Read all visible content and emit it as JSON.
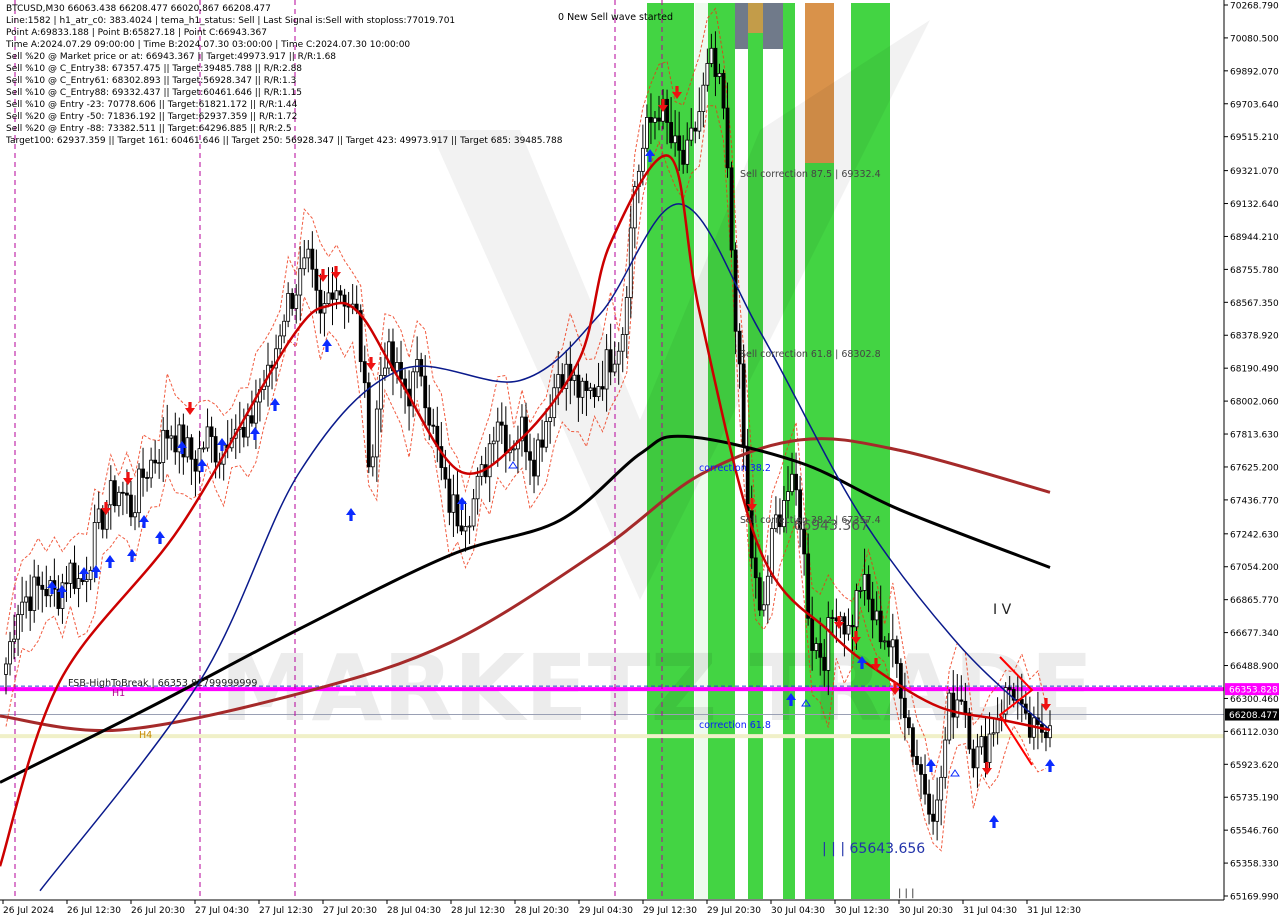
{
  "info_lines": [
    "BTCUSD,M30  66063.438 66208.477 66020.867 66208.477",
    "Line:1582  |  h1_atr_c0: 383.4024  |  tema_h1_status: Sell  |  Last Signal is:Sell with stoploss:77019.701",
    "Point A:69833.188  |  Point B:65827.18  |  Point C:66943.367",
    "Time A:2024.07.29 09:00:00  |  Time B:2024.07.30 03:00:00  |  Time C:2024.07.30 10:00:00",
    "Sell %20 @ Market price or at: 66943.367  ||  Target:49973.917  ||  R/R:1.68",
    "Sell %10 @ C_Entry38: 67357.475  ||  Target:39485.788  ||  R/R:2.88",
    "Sell %10 @ C_Entry61: 68302.893  ||  Target:56928.347  ||  R/R:1.3",
    "Sell %10 @ C_Entry88: 69332.437  ||  Target:60461.646  ||  R/R:1.15",
    "Sell %10 @ Entry -23: 70778.606  ||  Target:61821.172  ||  R/R:1.44",
    "Sell %20 @ Entry -50: 71836.192  ||  Target:62937.359  ||  R/R:1.72",
    "Sell %20 @ Entry -88: 73382.511  ||  Target:64296.885  ||  R/R:2.5",
    "Target100: 62937.359  ||  Target 161: 60461.646  ||  Target 250: 56928.347  ||  Target 423: 49973.917  ||  Target 685: 39485.788"
  ],
  "annotations": {
    "new_wave": "0 New Sell wave started",
    "sell_corr_875": "Sell correction 87.5 | 69332.4",
    "sell_corr_618": "Sell correction 61.8 | 68302.8",
    "sell_corr_382": "Sell correction 38.2 | 67357.4",
    "correction_382": "correction 38.2",
    "correction_618": "correction 61.8",
    "point_c": "| | 66943.367",
    "point_b": "| | | 65643.656",
    "wave_iv": "I V",
    "fsb": "FSB-HighToBreak  |  66353.82799999999",
    "h1": "H1",
    "h4": "H4",
    "watermark": "MARKETZ TRADE",
    "bottom_marks": "| | |"
  },
  "price_tags": {
    "fsb": "66353.828",
    "current": "66208.477"
  },
  "colors": {
    "fsb_line": "#ff00ff",
    "current_line": "#9aa0b4",
    "h4_line": "#f0f0c8",
    "ema_red": "#cc0000",
    "ema_navy": "#0a1a8c",
    "ema_black": "#000000",
    "ema_brown": "#a52a2a",
    "green_band": "#22cc22",
    "orange_block": "#d9924a",
    "grey_block": "#707a8a",
    "dotted_red": "#ee3311",
    "vline": "#b4009a",
    "bull_arrow": "#0b2bff",
    "bear_arrow": "#ee1111"
  },
  "chart_data": {
    "type": "candlestick",
    "symbol": "BTCUSD",
    "timeframe": "M30",
    "ohlc_last": {
      "open": 66063.438,
      "high": 66208.477,
      "low": 66020.867,
      "close": 66208.477
    },
    "ylim": [
      65169.99,
      70268.79
    ],
    "y_ticks": [
      "70268.790",
      "70080.500",
      "69892.070",
      "69703.640",
      "69515.210",
      "69321.070",
      "69132.640",
      "68944.210",
      "68755.780",
      "68567.350",
      "68378.920",
      "68190.490",
      "68002.060",
      "67813.630",
      "67625.200",
      "67436.770",
      "67242.630",
      "67054.200",
      "66865.770",
      "66677.340",
      "66488.900",
      "66300.460",
      "66112.030",
      "65923.620",
      "65735.190",
      "65546.760",
      "65358.330",
      "65169.990"
    ],
    "x_labels": [
      "26 Jul 2024",
      "26 Jul 12:30",
      "26 Jul 20:30",
      "27 Jul 04:30",
      "27 Jul 12:30",
      "27 Jul 20:30",
      "28 Jul 04:30",
      "28 Jul 12:30",
      "28 Jul 20:30",
      "29 Jul 04:30",
      "29 Jul 12:30",
      "29 Jul 20:30",
      "30 Jul 04:30",
      "30 Jul 12:30",
      "30 Jul 20:30",
      "31 Jul 04:30",
      "31 Jul 12:30"
    ],
    "close_path": [
      66500,
      66850,
      66900,
      66950,
      66880,
      67050,
      66950,
      67200,
      67420,
      67500,
      67380,
      67600,
      67700,
      67850,
      67750,
      67650,
      67800,
      67700,
      67900,
      67750,
      68050,
      68150,
      68500,
      68650,
      68780,
      68450,
      68700,
      68600,
      68450,
      67600,
      68300,
      68150,
      68050,
      68200,
      67800,
      67450,
      67350,
      67400,
      67600,
      67950,
      67750,
      67850,
      67680,
      67920,
      68200,
      68120,
      68000,
      68100,
      68250,
      68400,
      69250,
      69550,
      69700,
      69450,
      69350,
      69620,
      69950,
      69700,
      68500,
      67300,
      66700,
      67250,
      67500,
      67450,
      66650,
      66550,
      66850,
      66680,
      66980,
      66750,
      66650,
      66450,
      66050,
      65800,
      65650,
      66250,
      66350,
      65950,
      66050,
      66250,
      66380,
      66120,
      66080,
      66208
    ],
    "levels": {
      "fsb_high_to_break": 66353.828,
      "current_price": 66208.477,
      "point_a": 69833.188,
      "point_b": 65827.18,
      "point_c": 66943.367,
      "c_entry38": 67357.475,
      "c_entry61": 68302.893,
      "c_entry88": 69332.437,
      "stoploss": 77019.701
    },
    "ema_red": [
      [
        0,
        65340
      ],
      [
        60,
        66400
      ],
      [
        180,
        67280
      ],
      [
        290,
        68350
      ],
      [
        330,
        68550
      ],
      [
        360,
        68500
      ],
      [
        400,
        68120
      ],
      [
        460,
        67600
      ],
      [
        520,
        67780
      ],
      [
        580,
        68250
      ],
      [
        610,
        68900
      ],
      [
        670,
        69400
      ],
      [
        700,
        68500
      ],
      [
        760,
        67150
      ],
      [
        830,
        66680
      ],
      [
        880,
        66450
      ],
      [
        940,
        66250
      ],
      [
        1000,
        66180
      ],
      [
        1050,
        66120
      ]
    ],
    "ema_navy": [
      [
        40,
        65200
      ],
      [
        200,
        66400
      ],
      [
        300,
        67600
      ],
      [
        400,
        68180
      ],
      [
        520,
        68120
      ],
      [
        600,
        68500
      ],
      [
        680,
        69130
      ],
      [
        760,
        68400
      ],
      [
        860,
        67350
      ],
      [
        960,
        66600
      ],
      [
        1050,
        66120
      ]
    ],
    "ema_black": [
      [
        0,
        65820
      ],
      [
        150,
        66250
      ],
      [
        300,
        66700
      ],
      [
        450,
        67120
      ],
      [
        560,
        67320
      ],
      [
        640,
        67700
      ],
      [
        685,
        67800
      ],
      [
        800,
        67650
      ],
      [
        900,
        67380
      ],
      [
        1050,
        67050
      ]
    ],
    "ema_brown": [
      [
        0,
        66200
      ],
      [
        120,
        66120
      ],
      [
        300,
        66330
      ],
      [
        450,
        66620
      ],
      [
        600,
        67150
      ],
      [
        700,
        67580
      ],
      [
        800,
        67780
      ],
      [
        900,
        67720
      ],
      [
        1050,
        67480
      ]
    ]
  }
}
